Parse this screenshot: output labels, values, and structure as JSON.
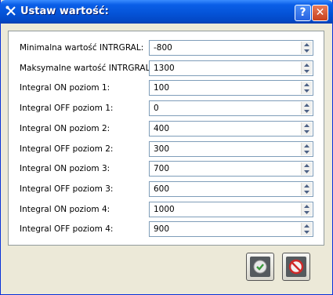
{
  "window": {
    "title": "Ustaw wartość:",
    "help_symbol": "?",
    "close_symbol": "✕"
  },
  "fields": [
    {
      "label": "Minimalna wartość INTRGRAL:",
      "value": "-800"
    },
    {
      "label": "Maksymalne wartość INTRGRAL:",
      "value": "1300"
    },
    {
      "label": "Integral ON poziom 1:",
      "value": "100"
    },
    {
      "label": "Integral OFF poziom 1:",
      "value": "0"
    },
    {
      "label": "Integral ON poziom 2:",
      "value": "400"
    },
    {
      "label": "Integral OFF poziom 2:",
      "value": "300"
    },
    {
      "label": "Integral ON poziom 3:",
      "value": "700"
    },
    {
      "label": "Integral OFF poziom 3:",
      "value": "600"
    },
    {
      "label": "Integral ON poziom 4:",
      "value": "1000"
    },
    {
      "label": "Integral OFF poziom 4:",
      "value": "900"
    }
  ],
  "icons": {
    "title": "tools-icon",
    "ok": "checkmark-icon",
    "cancel": "no-entry-icon",
    "spin_up": "arrow-up-icon",
    "spin_down": "arrow-down-icon"
  },
  "colors": {
    "titlebar": "#0452d6",
    "ok_icon": "#3a9a3a",
    "cancel_icon": "#d02828"
  }
}
